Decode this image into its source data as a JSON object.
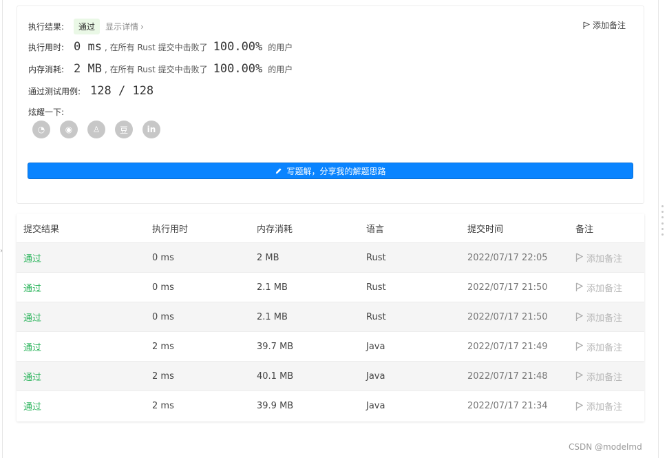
{
  "result": {
    "exec_result_label": "执行结果:",
    "status_badge": "通过",
    "show_details": "显示详情",
    "add_note": "添加备注",
    "runtime_label": "执行用时:",
    "runtime_value": "0 ms",
    "runtime_text": ", 在所有 Rust 提交中击败了",
    "runtime_percent": "100.00%",
    "runtime_suffix": "的用户",
    "memory_label": "内存消耗:",
    "memory_value": "2 MB",
    "memory_text": ", 在所有 Rust 提交中击败了",
    "memory_percent": "100.00%",
    "memory_suffix": "的用户",
    "testcases_label": "通过测试用例:",
    "testcases_value": "128 / 128",
    "share_label": "炫耀一下:",
    "share_icons": [
      "wechat-icon",
      "weibo-icon",
      "qq-icon",
      "douban-icon",
      "linkedin-icon"
    ],
    "share_glyphs": [
      "◔",
      "◉",
      "♙",
      "豆",
      "in"
    ],
    "write_solution": "写题解，分享我的解题思路"
  },
  "table": {
    "headers": [
      "提交结果",
      "执行用时",
      "内存消耗",
      "语言",
      "提交时间",
      "备注"
    ],
    "rows": [
      {
        "status": "通过",
        "time": "0 ms",
        "memory": "2 MB",
        "lang": "Rust",
        "submitted": "2022/07/17 22:05",
        "note": "添加备注"
      },
      {
        "status": "通过",
        "time": "0 ms",
        "memory": "2.1 MB",
        "lang": "Rust",
        "submitted": "2022/07/17 21:50",
        "note": "添加备注"
      },
      {
        "status": "通过",
        "time": "0 ms",
        "memory": "2.1 MB",
        "lang": "Rust",
        "submitted": "2022/07/17 21:50",
        "note": "添加备注"
      },
      {
        "status": "通过",
        "time": "2 ms",
        "memory": "39.7 MB",
        "lang": "Java",
        "submitted": "2022/07/17 21:49",
        "note": "添加备注"
      },
      {
        "status": "通过",
        "time": "2 ms",
        "memory": "40.1 MB",
        "lang": "Java",
        "submitted": "2022/07/17 21:48",
        "note": "添加备注"
      },
      {
        "status": "通过",
        "time": "2 ms",
        "memory": "39.9 MB",
        "lang": "Java",
        "submitted": "2022/07/17 21:34",
        "note": "添加备注"
      }
    ]
  },
  "watermark": "CSDN @modelmd",
  "colors": {
    "accent": "#0a84ff",
    "pass": "#2db55d",
    "badge_bg": "#eaf8e6"
  }
}
